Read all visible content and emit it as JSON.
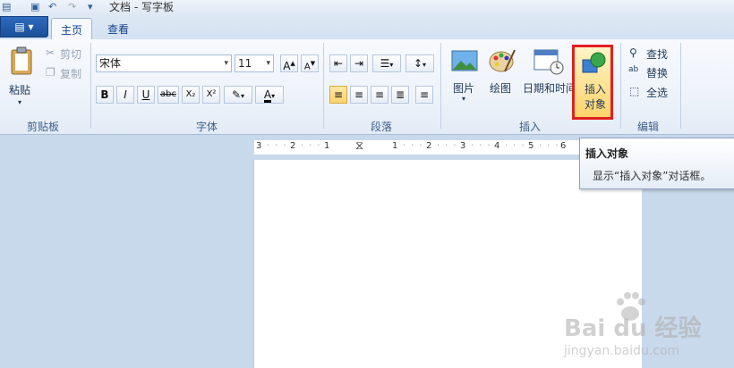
{
  "window": {
    "title": "文档 - 写字板"
  },
  "tabs": {
    "app_menu": "▤ ▾",
    "home": "主页",
    "view": "查看"
  },
  "clipboard": {
    "paste": "粘贴",
    "cut": "剪切",
    "copy": "复制",
    "group": "剪贴板"
  },
  "font": {
    "name": "宋体",
    "size": "11",
    "group": "字体",
    "bold": "B",
    "italic": "I",
    "underline": "U",
    "strike": "abc",
    "sub": "X₂",
    "sup": "X²"
  },
  "paragraph": {
    "group": "段落"
  },
  "insert": {
    "picture": "图片",
    "paint": "绘图",
    "datetime": "日期和时间",
    "object_line1": "插入",
    "object_line2": "对象",
    "group": "插入"
  },
  "editing": {
    "find": "查找",
    "replace": "替换",
    "select_all": "全选",
    "group": "编辑"
  },
  "ruler": {
    "marks": [
      "3",
      "2",
      "1",
      "1",
      "2",
      "3",
      "4",
      "5",
      "6"
    ]
  },
  "tooltip": {
    "title": "插入对象",
    "description": "显示“插入对象”对话框。"
  },
  "watermark": {
    "brand": "Bai du 经验",
    "url": "jingyan.baidu.com"
  },
  "colors": {
    "highlight_box": "#e02020",
    "accent": "#1b4f99",
    "ribbon_bg": "#eef3fa"
  }
}
